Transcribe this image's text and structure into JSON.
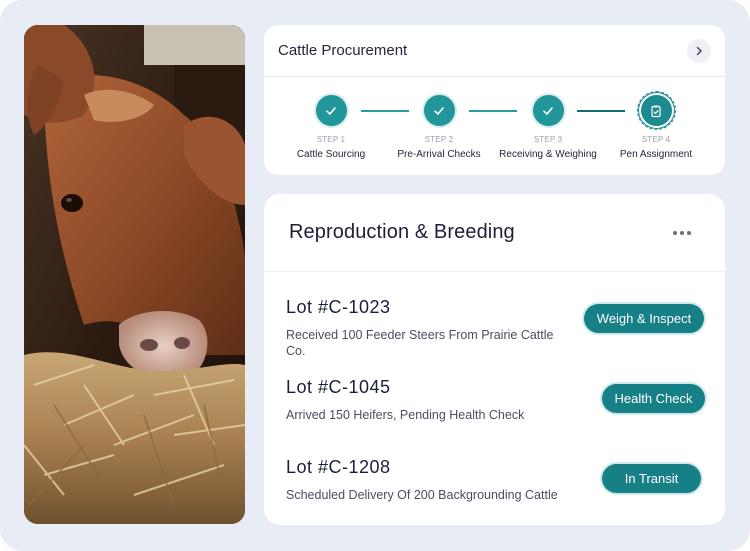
{
  "procurement": {
    "title": "Cattle Procurement",
    "steps": [
      {
        "number": "STEP 1",
        "label": "Cattle Sourcing",
        "status": "done"
      },
      {
        "number": "STEP 2",
        "label": "Pre-Arrival Checks",
        "status": "done"
      },
      {
        "number": "STEP 3",
        "label": "Receiving & Weighing",
        "status": "done"
      },
      {
        "number": "STEP 4",
        "label": "Pen Assignment",
        "status": "current"
      }
    ]
  },
  "breeding": {
    "title": "Reproduction & Breeding",
    "lots": [
      {
        "id": "Lot #C-1023",
        "description": "Received 100 Feeder Steers From Prairie Cattle Co.",
        "action": "Weigh & Inspect"
      },
      {
        "id": "Lot #C-1045",
        "description": "Arrived 150 Heifers, Pending Health Check",
        "action": "Health Check"
      },
      {
        "id": "Lot #C-1208",
        "description": "Scheduled Delivery Of 200 Backgrounding Cattle",
        "action": "In Transit"
      }
    ]
  },
  "colors": {
    "accent": "#177f86",
    "step": "#21969b",
    "background": "#e8ecf4"
  },
  "icons": {
    "next": "chevron-right-icon",
    "done": "check-icon",
    "current": "clipboard-check-icon",
    "menu": "more-dots-icon"
  }
}
